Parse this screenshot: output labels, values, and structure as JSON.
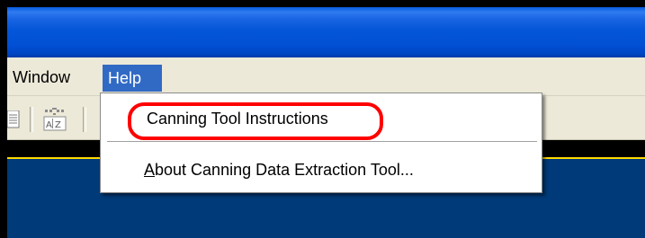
{
  "menubar": {
    "items": [
      {
        "label": "Window"
      },
      {
        "label": "Help",
        "active": true
      }
    ]
  },
  "toolbar": {
    "icons": [
      "document-icon",
      "sort-az-icon"
    ]
  },
  "help_menu": {
    "items": [
      {
        "label": "Canning Tool Instructions",
        "highlighted_by_annotation": true
      },
      {
        "label_underlined_char": "A",
        "label_rest": "bout Canning Data Extraction Tool..."
      }
    ]
  },
  "annotation": {
    "color": "#ff0000"
  },
  "colors": {
    "titlebar": "#0250d4",
    "menubar": "#ece9d8",
    "menu_active": "#316ac5",
    "workspace": "#003a78",
    "accent_line": "#ffd800"
  }
}
